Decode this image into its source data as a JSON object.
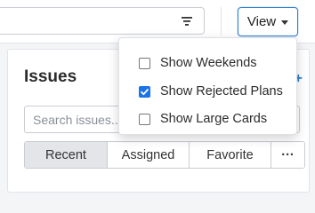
{
  "toolbar": {
    "filter_icon": "filter-icon",
    "view_button_label": "View",
    "view_caret_icon": "caret-down-icon"
  },
  "panel": {
    "title": "Issues",
    "search_placeholder": "Search issues...",
    "tabs": [
      {
        "label": "Recent",
        "active": true
      },
      {
        "label": "Assigned",
        "active": false
      },
      {
        "label": "Favorite",
        "active": false
      },
      {
        "label": "···",
        "active": false
      }
    ]
  },
  "view_menu": {
    "items": [
      {
        "label": "Show Weekends",
        "checked": false
      },
      {
        "label": "Show Rejected Plans",
        "checked": true
      },
      {
        "label": "Show Large Cards",
        "checked": false
      }
    ]
  },
  "colors": {
    "accent": "#2f7fd1",
    "checkbox_checked": "#1a73e8",
    "active_tab_bg": "#e4e5e8"
  }
}
